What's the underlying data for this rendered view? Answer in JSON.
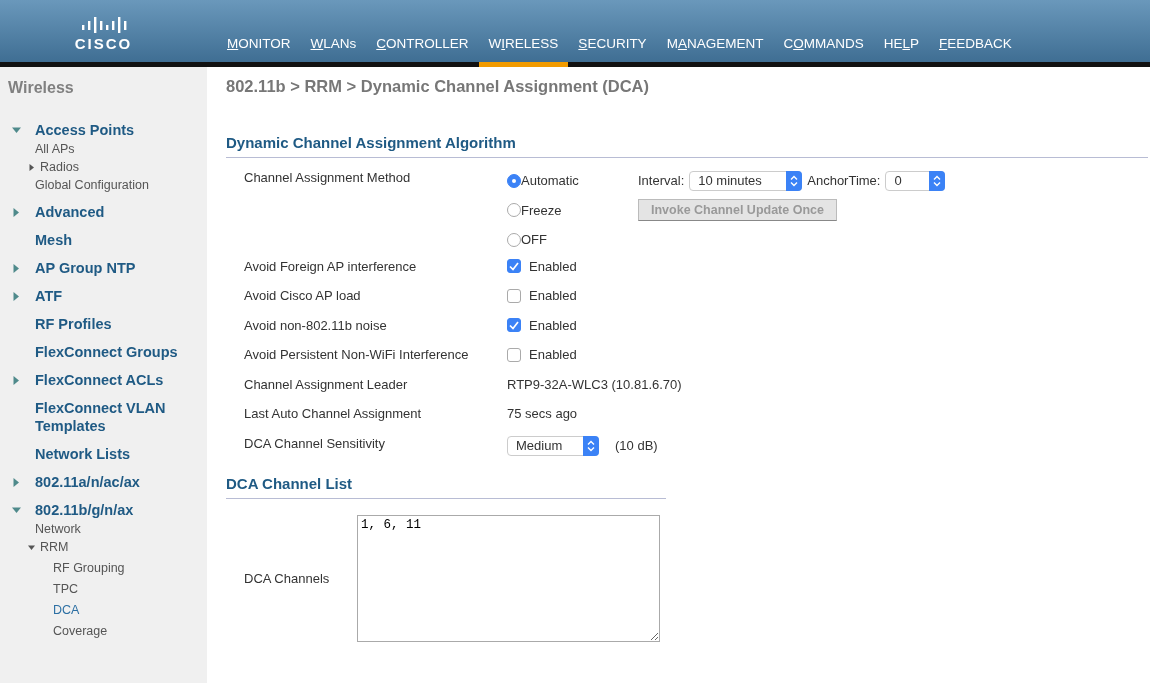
{
  "header": {
    "logo_text": "CISCO",
    "menu": [
      {
        "key": "M",
        "post": "ONITOR",
        "selected": false
      },
      {
        "key": "W",
        "post": "LANs",
        "selected": false
      },
      {
        "key": "C",
        "post": "ONTROLLER",
        "selected": false
      },
      {
        "pre": "W",
        "key": "I",
        "post": "RELESS",
        "selected": true
      },
      {
        "key": "S",
        "post": "ECURITY",
        "selected": false
      },
      {
        "pre": "M",
        "key": "A",
        "post": "NAGEMENT",
        "selected": false
      },
      {
        "pre": "C",
        "key": "O",
        "post": "MMANDS",
        "selected": false
      },
      {
        "pre": "HE",
        "key": "L",
        "post": "P",
        "selected": false
      },
      {
        "key": "F",
        "post": "EEDBACK",
        "selected": false
      }
    ]
  },
  "sidebar": {
    "title": "Wireless",
    "items": [
      {
        "label": "Access Points",
        "expanded": true,
        "selected": false,
        "children": [
          {
            "label": "All APs",
            "selected": false
          },
          {
            "label": "Radios",
            "expanded": false,
            "selected": false
          },
          {
            "label": "Global Configuration",
            "selected": false
          }
        ]
      },
      {
        "label": "Advanced",
        "expanded": false,
        "selected": false
      },
      {
        "label": "Mesh",
        "selected": false
      },
      {
        "label": "AP Group NTP",
        "expanded": false,
        "selected": false
      },
      {
        "label": "ATF",
        "expanded": false,
        "selected": false
      },
      {
        "label": "RF Profiles",
        "selected": false
      },
      {
        "label": "FlexConnect Groups",
        "selected": false
      },
      {
        "label": "FlexConnect ACLs",
        "expanded": false,
        "selected": false
      },
      {
        "label": "FlexConnect VLAN Templates",
        "selected": false
      },
      {
        "label": "Network Lists",
        "selected": false
      },
      {
        "label": "802.11a/n/ac/ax",
        "expanded": false,
        "selected": false
      },
      {
        "label": "802.11b/g/n/ax",
        "expanded": true,
        "selected": false,
        "children": [
          {
            "label": "Network",
            "selected": false
          },
          {
            "label": "RRM",
            "expanded": true,
            "selected": false,
            "children": [
              {
                "label": "RF Grouping",
                "selected": false
              },
              {
                "label": "TPC",
                "selected": false
              },
              {
                "label": "DCA",
                "selected": true
              },
              {
                "label": "Coverage",
                "selected": false
              }
            ]
          }
        ]
      }
    ]
  },
  "page_title": "802.11b > RRM > Dynamic Channel Assignment (DCA)",
  "algorithm": {
    "title": "Dynamic Channel Assignment Algorithm",
    "method": {
      "label": "Channel Assignment Method",
      "options": [
        {
          "label": "Automatic",
          "selected": true
        },
        {
          "label": "Freeze",
          "selected": false
        },
        {
          "label": "OFF",
          "selected": false
        }
      ],
      "interval": {
        "label": "Interval:",
        "value": "10 minutes"
      },
      "anchor": {
        "label": "AnchorTime:",
        "value": "0"
      },
      "invoke_button": {
        "label": "Invoke Channel Update Once",
        "disabled": true
      }
    },
    "toggles": [
      {
        "label": "Avoid Foreign AP interference",
        "checked": true,
        "option": "Enabled"
      },
      {
        "label": "Avoid Cisco AP load",
        "checked": false,
        "option": "Enabled"
      },
      {
        "label": "Avoid non-802.11b noise",
        "checked": true,
        "option": "Enabled"
      },
      {
        "label": "Avoid Persistent Non-WiFi Interference",
        "checked": false,
        "option": "Enabled"
      }
    ],
    "info": [
      {
        "label": "Channel Assignment Leader",
        "value": "RTP9-32A-WLC3 (10.81.6.70)"
      },
      {
        "label": "Last Auto Channel Assignment",
        "value": "75 secs ago"
      }
    ],
    "sensitivity": {
      "label": "DCA Channel Sensitivity",
      "value": "Medium",
      "reading": "(10 dB)"
    }
  },
  "channel_list": {
    "title": "DCA Channel List",
    "label": "DCA Channels",
    "value": "1, 6, 11"
  }
}
